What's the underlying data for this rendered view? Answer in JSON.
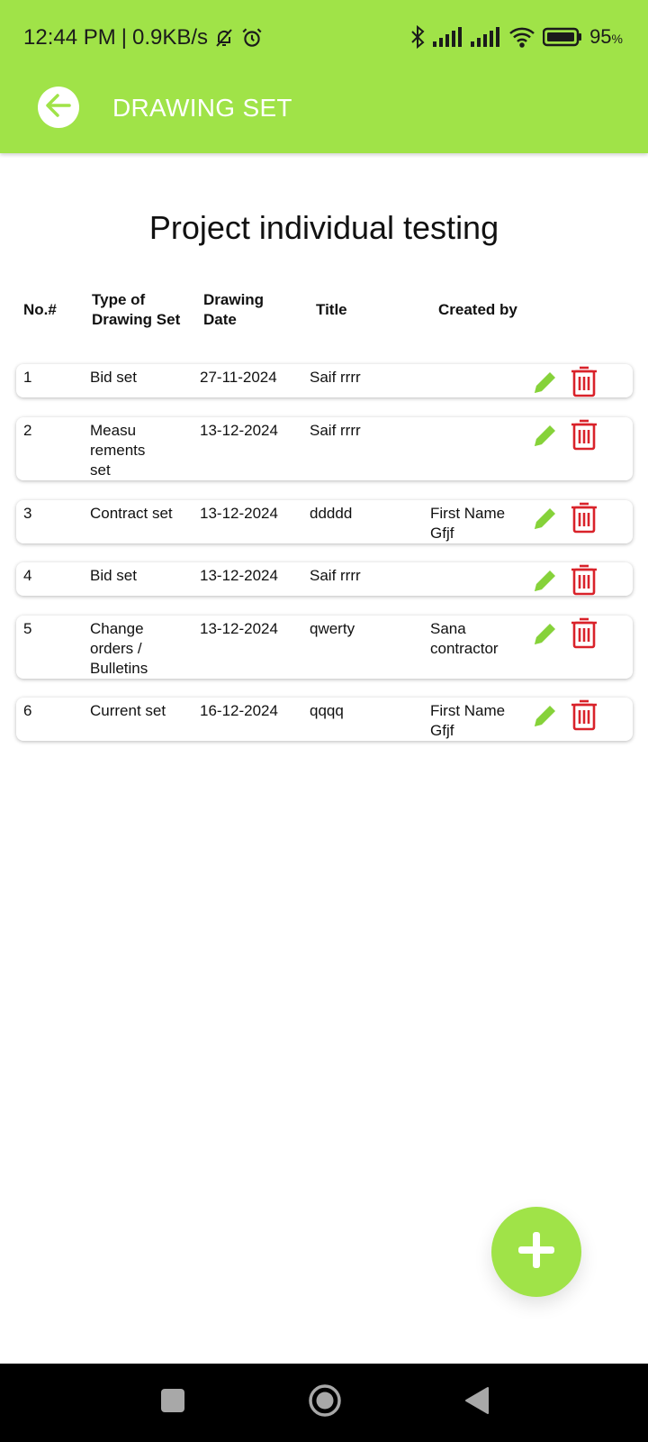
{
  "status_bar": {
    "time": "12:44 PM",
    "separator": "|",
    "speed": "0.9KB/s",
    "battery_percent": "95",
    "battery_unit": "%",
    "icons": [
      "bell-muted-icon",
      "alarm-icon",
      "bluetooth-icon",
      "signal-icon",
      "signal-icon",
      "wifi-icon",
      "battery-icon"
    ]
  },
  "header": {
    "title": "DRAWING SET",
    "back_icon": "arrow-left-icon"
  },
  "page": {
    "title": "Project individual testing"
  },
  "table": {
    "columns": [
      "No.#",
      "Type of\nDrawing Set",
      "Drawing\nDate",
      "Title",
      "Created by"
    ],
    "rows": [
      {
        "no": "1",
        "type": "Bid set",
        "date": "27-11-2024",
        "title": "Saif rrrr",
        "created_by": ""
      },
      {
        "no": "2",
        "type": "Measu\nrements\nset",
        "date": "13-12-2024",
        "title": "Saif rrrr",
        "created_by": ""
      },
      {
        "no": "3",
        "type": "Contract set",
        "date": "13-12-2024",
        "title": "ddddd",
        "created_by": "First Name\nGfjf"
      },
      {
        "no": "4",
        "type": "Bid set",
        "date": "13-12-2024",
        "title": "Saif rrrr",
        "created_by": ""
      },
      {
        "no": "5",
        "type": "Change\norders /\nBulletins",
        "date": "13-12-2024",
        "title": "qwerty",
        "created_by": "Sana\ncontractor"
      },
      {
        "no": "6",
        "type": "Current set",
        "date": "16-12-2024",
        "title": "qqqq",
        "created_by": "First Name\nGfjf"
      }
    ],
    "row_icons": {
      "edit": "pencil-icon",
      "delete": "trash-icon"
    }
  },
  "fab": {
    "icon": "plus-icon"
  },
  "nav_bar": {
    "icons": [
      "recents-square-icon",
      "home-circle-icon",
      "back-triangle-icon"
    ]
  },
  "colors": {
    "accent": "#a0e348",
    "edit_icon": "#86d23a",
    "delete_icon": "#d9222a",
    "header_text": "#ffffff",
    "nav_bar": "#000000"
  }
}
